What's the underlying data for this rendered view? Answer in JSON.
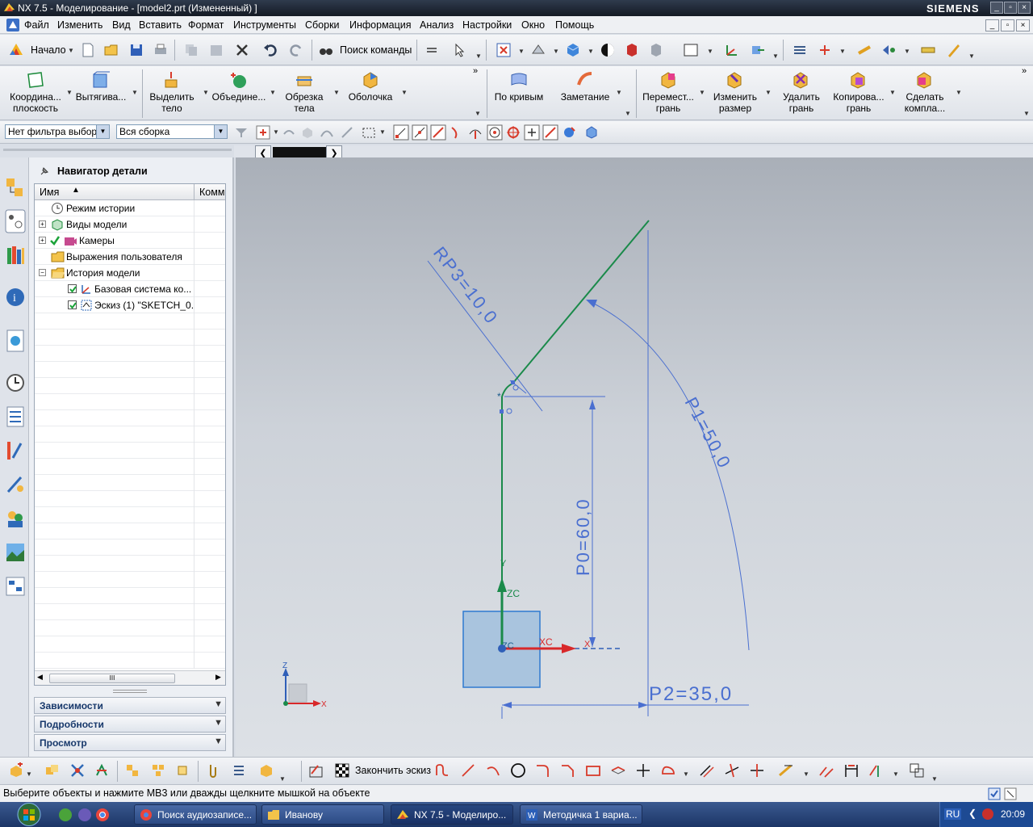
{
  "window": {
    "title": "NX 7.5 - Моделирование - [model2.prt (Измененный) ]",
    "brand": "SIEMENS"
  },
  "menu": [
    "Файл",
    "Изменить",
    "Вид",
    "Вставить",
    "Формат",
    "Инструменты",
    "Сборки",
    "Информация",
    "Анализ",
    "Настройки",
    "Окно",
    "Помощь"
  ],
  "toolbar1": {
    "start_label": "Начало",
    "search_label": "Поиск команды"
  },
  "toolbar2": {
    "items": [
      {
        "line1": "Координа...",
        "line2": "плоскость"
      },
      {
        "line1": "Вытягива...",
        "line2": ""
      },
      {
        "line1": "Выделить",
        "line2": "тело"
      },
      {
        "line1": "Объедине...",
        "line2": ""
      },
      {
        "line1": "Обрезка",
        "line2": "тела"
      },
      {
        "line1": "Оболочка",
        "line2": ""
      },
      {
        "line1": "По кривым",
        "line2": ""
      },
      {
        "line1": "Заметание",
        "line2": ""
      },
      {
        "line1": "Перемест...",
        "line2": "грань"
      },
      {
        "line1": "Изменить",
        "line2": "размер"
      },
      {
        "line1": "Удалить",
        "line2": "грань"
      },
      {
        "line1": "Копирова...",
        "line2": "грань"
      },
      {
        "line1": "Сделать",
        "line2": "компла..."
      }
    ]
  },
  "filters": {
    "selection_filter": "Нет фильтра выбора",
    "scope": "Вся сборка"
  },
  "navigator": {
    "title": "Навигатор детали",
    "col_name": "Имя",
    "col_comment": "Комм",
    "rows": [
      {
        "label": "Режим истории",
        "icon": "clock-icon"
      },
      {
        "label": "Виды модели",
        "icon": "model-views-icon"
      },
      {
        "label": "Камеры",
        "icon": "camera-icon"
      },
      {
        "label": "Выражения пользователя",
        "icon": "folder-icon"
      },
      {
        "label": "История модели",
        "icon": "folder-open-icon"
      },
      {
        "label": "Базовая система ко...",
        "icon": "datum-csys-icon"
      },
      {
        "label": "Эскиз (1) \"SKETCH_0...",
        "icon": "sketch-icon"
      }
    ],
    "panels": [
      "Зависимости",
      "Подробности",
      "Просмотр"
    ]
  },
  "sketch": {
    "dim_rp3": "RP3=10,0",
    "dim_p1": "P1=50,0",
    "dim_p0": "P0=60,0",
    "dim_p2": "P2=35,0",
    "label_xc": "XC",
    "label_zc": "ZC",
    "label_zc2": "ZC",
    "label_x": "X",
    "label_y": "Y",
    "triad_z": "Z",
    "triad_x": "X"
  },
  "bottom_toolbar": {
    "finish_sketch": "Закончить эскиз"
  },
  "status": "Выберите объекты и нажмите МВ3 или дважды щелкните мышкой на объекте",
  "taskbar": {
    "tasks": [
      "Поиск аудиозаписе...",
      "Иванову",
      "NX 7.5 - Моделиро...",
      "Методичка 1 вариа..."
    ],
    "lang": "RU",
    "clock": "20:09"
  },
  "colors": {
    "sketch_green": "#1a8a4a",
    "dimension_blue": "#4a6fd0",
    "axis_red": "#d8282a",
    "title_dark": "#1b2331"
  }
}
